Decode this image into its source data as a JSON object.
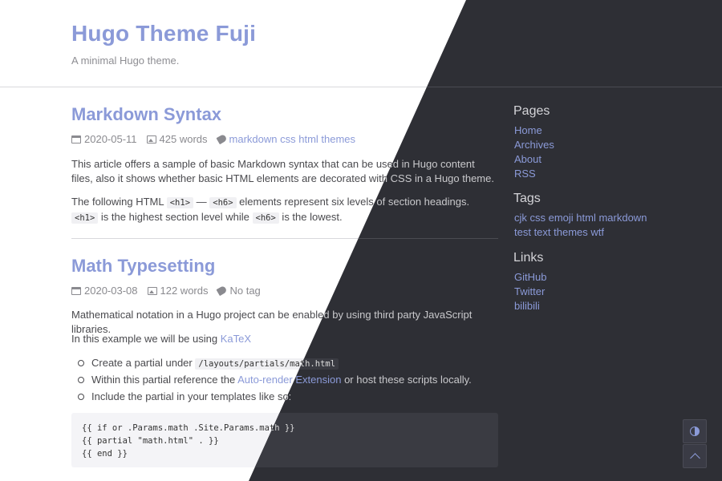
{
  "site": {
    "title": "Hugo Theme Fuji",
    "description": "A minimal Hugo theme."
  },
  "posts": [
    {
      "title": "Markdown Syntax",
      "date": "2020-05-11",
      "words": "425 words",
      "tags": "markdown css html themes",
      "p1": "This article offers a sample of basic Markdown syntax that can be used in Hugo content files, also it shows whether basic HTML elements are decorated with CSS in a Hugo theme.",
      "p2_a": "The following HTML ",
      "code_h1": "<h1>",
      "p2_dash": " — ",
      "code_h6": "<h6>",
      "p2_b": " elements represent six levels of section headings. ",
      "code_h1b": "<h1>",
      "p2_c": " is the highest section level while ",
      "code_h6b": "<h6>",
      "p2_d": " is the lowest."
    },
    {
      "title": "Math Typesetting",
      "date": "2020-03-08",
      "words": "122 words",
      "tags": "No tag",
      "p1": "Mathematical notation in a Hugo project can be enabled by using third party JavaScript libraries.",
      "p2_a": "In this example we will be using ",
      "p2_link": "KaTeX",
      "bullet1_a": "Create a partial under ",
      "bullet1_code": "/layouts/partials/math.html",
      "bullet2_a": "Within this partial reference the ",
      "bullet2_link": "Auto-render Extension",
      "bullet2_b": " or host these scripts locally.",
      "bullet3": "Include the partial in your templates like so:",
      "code_lines": [
        "{{ if or .Params.math .Site.Params.math }}",
        "{{ partial \"math.html\" . }}",
        "{{ end }}"
      ]
    }
  ],
  "sidebar": {
    "pages_heading": "Pages",
    "pages": [
      "Home",
      "Archives",
      "About",
      "RSS"
    ],
    "tags_heading": "Tags",
    "tags_line1": "cjk css emoji html markdown",
    "tags_line2": "test text themes wtf",
    "links_heading": "Links",
    "links": [
      "GitHub",
      "Twitter",
      "bilibili"
    ]
  },
  "colors": {
    "accent": "#8b9ad8",
    "dark_bg": "#2e2f35",
    "light_bg": "#ffffff"
  },
  "icons": {
    "theme_toggle": "contrast-icon",
    "back_to_top": "chevron-up-icon"
  }
}
